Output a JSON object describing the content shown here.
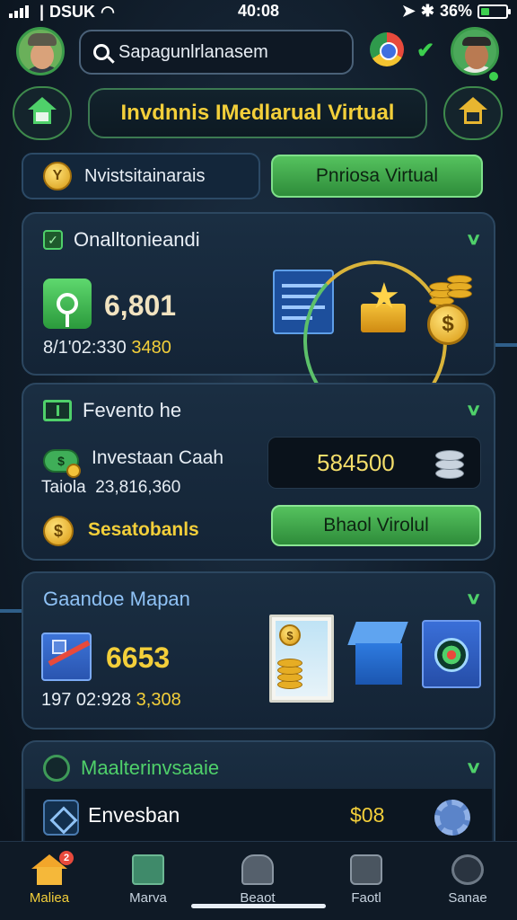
{
  "status_bar": {
    "carrier": "DSUK",
    "time": "40:08",
    "battery": "36%",
    "battery_level": 0.36
  },
  "header": {
    "search_text": "Sapagunlrlanasem"
  },
  "title_bar": {
    "title": "Invdnnis IMedlarual Virtual"
  },
  "tabs": {
    "left_label": "Nvistsitainarais",
    "left_icon_glyph": "Y",
    "right_label": "Pnriosa Virtual"
  },
  "cards": [
    {
      "title": "Onalltonieandi",
      "value": "6,801",
      "sub_prefix": "8/1'02:330",
      "sub_gold": "3480",
      "coin_glyph": "$"
    },
    {
      "title": "Fevento he",
      "row_label": "Investaan Caah",
      "row_sub_prefix": "Taiola",
      "row_sub_value": "23,816,360",
      "box_value": "584500",
      "button_label": "Bhaol Virolul",
      "gold_label": "Sesatobanls",
      "money_glyph": "$",
      "coin_glyph": "$"
    },
    {
      "title": "Gaandoe Mapan",
      "value": "6653",
      "sub_prefix": "197 02:928",
      "sub_gold": "3,308",
      "coin_glyph": "$"
    },
    {
      "title": "Maalterinvsaaie",
      "row_label": "Envesban",
      "row_value": "$08"
    }
  ],
  "bottom_nav": [
    {
      "label": "Maliea",
      "badge": "2",
      "icon": "home-icon"
    },
    {
      "label": "Marva",
      "icon": "message-icon"
    },
    {
      "label": "Beaot",
      "icon": "lock-icon"
    },
    {
      "label": "Faotl",
      "icon": "face-icon"
    },
    {
      "label": "Sanae",
      "icon": "user-icon"
    }
  ],
  "colors": {
    "accent_green": "#4fd06a",
    "accent_gold": "#f3cf3a",
    "background": "#101c29",
    "card": "#1a2e42"
  }
}
